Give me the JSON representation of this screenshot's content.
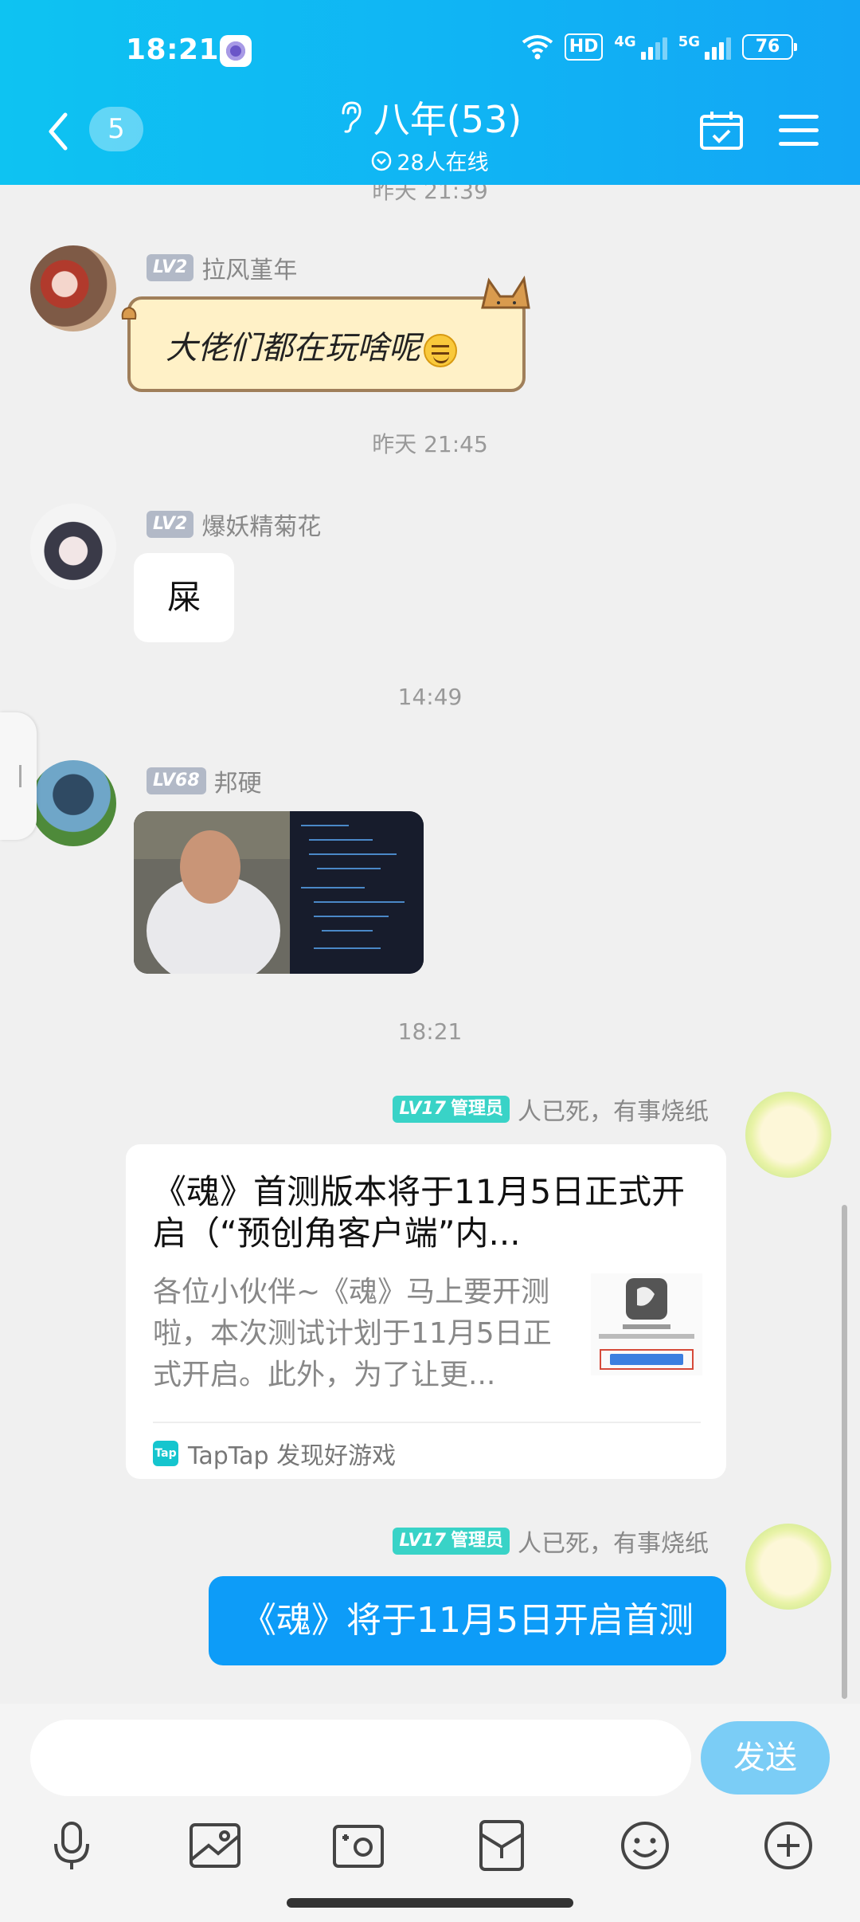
{
  "status_bar": {
    "time": "18:21",
    "hd_label": "HD",
    "net1": "4G",
    "net2": "5G",
    "battery": "76"
  },
  "header": {
    "unread_count": "5",
    "title": "八年(53)",
    "online": "28人在线"
  },
  "messages": {
    "ts_prev": "昨天 21:39",
    "m1": {
      "level": "LV2",
      "name": "拉风堇年",
      "text": "大佬们都在玩啥呢"
    },
    "ts1": "昨天 21:45",
    "m2": {
      "level": "LV2",
      "name": "爆妖精菊花",
      "text": "屎"
    },
    "ts2": "14:49",
    "m3": {
      "level": "LV68",
      "name": "邦硬"
    },
    "ts3": "18:21",
    "m4": {
      "level": "LV17",
      "role": "管理员",
      "name": "人已死，有事烧纸",
      "card_title": "《魂》首测版本将于11月5日正式开启（“预创角客户端”内...",
      "card_desc": "各位小伙伴~《魂》马上要开测啦，本次测试计划于11月5日正式开启。此外，为了让更...",
      "card_source": "TapTap 发现好游戏"
    },
    "m5": {
      "level": "LV17",
      "role": "管理员",
      "name": "人已死，有事烧纸",
      "text": "《魂》将于11月5日开启首测"
    }
  },
  "input": {
    "placeholder": "",
    "send_label": "发送"
  },
  "colors": {
    "header_blue": "#10b4f4",
    "bubble_blue": "#0d9cf8",
    "admin_badge": "#39d3c7",
    "level_badge": "#b2b9c7"
  }
}
